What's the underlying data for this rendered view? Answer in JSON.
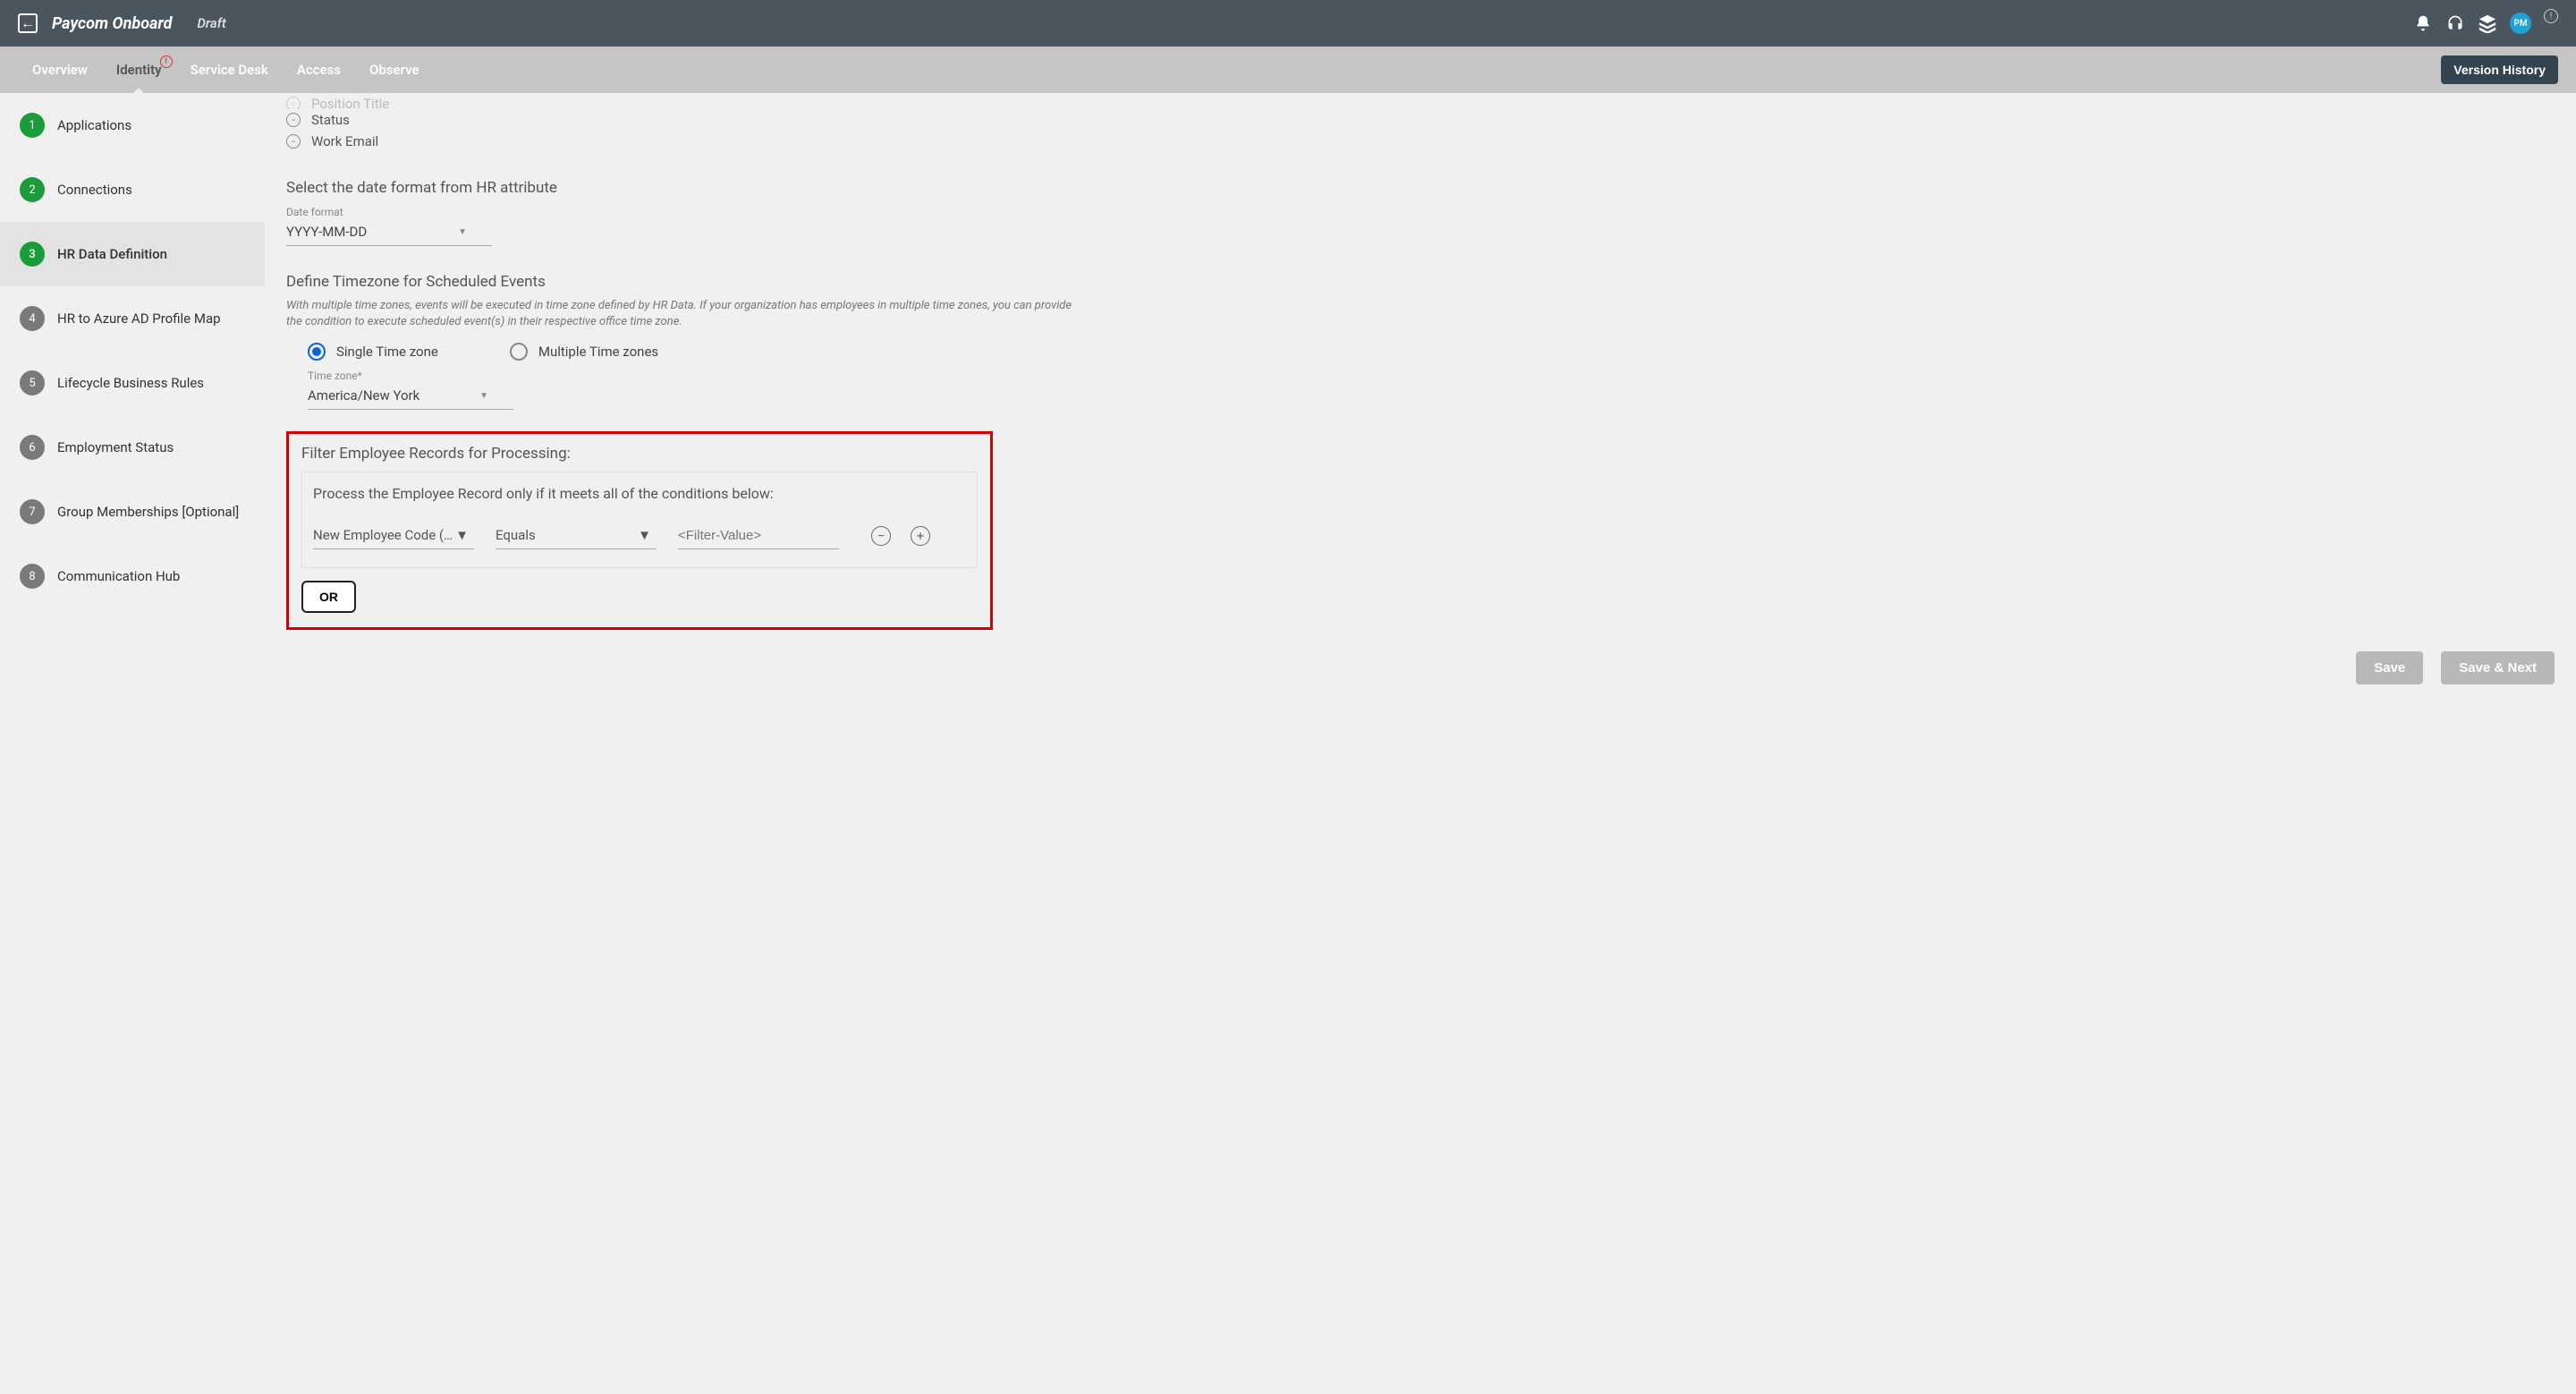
{
  "header": {
    "title": "Paycom Onboard",
    "status": "Draft",
    "avatar": "PM"
  },
  "tabs": {
    "items": [
      "Overview",
      "Identity",
      "Service Desk",
      "Access",
      "Observe"
    ],
    "active_index": 1,
    "version_button": "Version History"
  },
  "sidebar": {
    "steps": [
      {
        "num": "1",
        "label": "Applications",
        "done": true
      },
      {
        "num": "2",
        "label": "Connections",
        "done": true
      },
      {
        "num": "3",
        "label": "HR Data Definition",
        "done": true,
        "active": true
      },
      {
        "num": "4",
        "label": "HR to Azure AD Profile Map",
        "done": false
      },
      {
        "num": "5",
        "label": "Lifecycle Business Rules",
        "done": false
      },
      {
        "num": "6",
        "label": "Employment Status",
        "done": false
      },
      {
        "num": "7",
        "label": "Group Memberships [Optional]",
        "done": false
      },
      {
        "num": "8",
        "label": "Communication Hub",
        "done": false
      }
    ]
  },
  "attrs": {
    "visible": [
      "Position Title",
      "Status",
      "Work Email"
    ]
  },
  "date_section": {
    "title": "Select the date format from HR attribute",
    "label": "Date format",
    "value": "YYYY-MM-DD"
  },
  "tz_section": {
    "title": "Define Timezone for Scheduled Events",
    "desc": "With multiple time zones, events will be executed in time zone defined by HR Data. If your organization has employees in multiple time zones, you can provide the condition to execute scheduled event(s) in their respective office time zone.",
    "option_single": "Single Time zone",
    "option_multi": "Multiple Time zones",
    "tz_label": "Time zone*",
    "tz_value": "America/New York"
  },
  "filter_section": {
    "title": "Filter Employee Records for Processing:",
    "cond_text": "Process the Employee Record only if it meets all of the conditions below:",
    "attr_value": "New Employee Code (…",
    "op_value": "Equals",
    "filter_placeholder": "<Filter-Value>",
    "or_label": "OR"
  },
  "footer": {
    "save": "Save",
    "save_next": "Save & Next"
  }
}
